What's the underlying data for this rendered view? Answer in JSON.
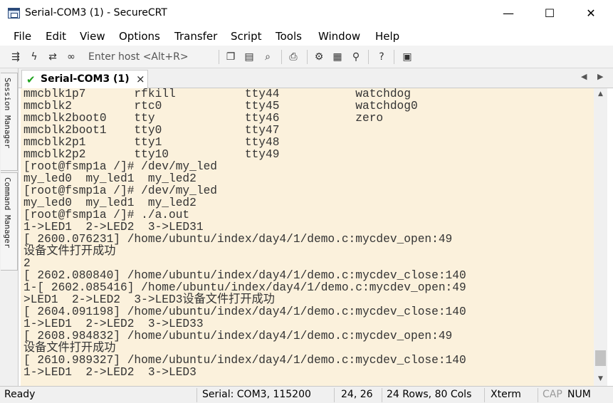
{
  "window": {
    "title": "Serial-COM3 (1) - SecureCRT",
    "minimize": "—",
    "maximize": "☐",
    "close": "✕"
  },
  "menu": [
    "File",
    "Edit",
    "View",
    "Options",
    "Transfer",
    "Script",
    "Tools",
    "Window",
    "Help"
  ],
  "toolbar": {
    "icons": [
      "connect-icon",
      "lightning-icon",
      "reconnect-icon",
      "disconnect-icon",
      "copy-icon",
      "paste-icon",
      "find-icon",
      "print-icon",
      "settings-icon",
      "keymap-icon",
      "sftp-icon",
      "help-icon",
      "keygen-icon"
    ],
    "quick_connect_placeholder": "Enter host <Alt+R>"
  },
  "side_tabs": {
    "session_manager": "Session Manager",
    "command_manager": "Command Manager"
  },
  "session_tab": {
    "label": "Serial-COM3 (1)",
    "status_color": "#1fa31f"
  },
  "terminal": {
    "background": "#fbf1dc",
    "lines": [
      "mmcblk1p7       rfkill          tty44           watchdog",
      "mmcblk2         rtc0            tty45           watchdog0",
      "mmcblk2boot0    tty             tty46           zero",
      "mmcblk2boot1    tty0            tty47",
      "mmcblk2p1       tty1            tty48",
      "mmcblk2p2       tty10           tty49",
      "[root@fsmp1a /]# /dev/my_led",
      "my_led0  my_led1  my_led2",
      "[root@fsmp1a /]# /dev/my_led",
      "my_led0  my_led1  my_led2",
      "[root@fsmp1a /]# ./a.out",
      "1->LED1  2->LED2  3->LED31",
      "[ 2600.076231] /home/ubuntu/index/day4/1/demo.c:mycdev_open:49",
      "设备文件打开成功",
      "2",
      "[ 2602.080840] /home/ubuntu/index/day4/1/demo.c:mycdev_close:140",
      "1-[ 2602.085416] /home/ubuntu/index/day4/1/demo.c:mycdev_open:49",
      ">LED1  2->LED2  3->LED3设备文件打开成功",
      "[ 2604.091198] /home/ubuntu/index/day4/1/demo.c:mycdev_close:140",
      "1->LED1  2->LED2  3->LED33",
      "[ 2608.984832] /home/ubuntu/index/day4/1/demo.c:mycdev_open:49",
      "设备文件打开成功",
      "[ 2610.989327] /home/ubuntu/index/day4/1/demo.c:mycdev_close:140",
      "1->LED1  2->LED2  3->LED3"
    ]
  },
  "statusbar": {
    "ready": "Ready",
    "connection": "Serial: COM3, 115200",
    "cursor": "24,  26",
    "size": "24 Rows, 80 Cols",
    "terminal_type": "Xterm",
    "caps": "CAP",
    "num": "NUM"
  }
}
